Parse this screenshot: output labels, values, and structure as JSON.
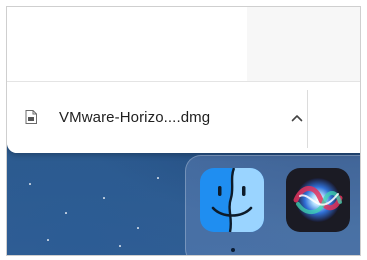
{
  "download_shelf": {
    "file_name": "VMware-Horizo....dmg",
    "file_icon": "file-icon",
    "menu_icon": "chevron-up-icon"
  },
  "dock": {
    "apps": [
      {
        "name": "Finder",
        "icon": "finder-icon",
        "running": true
      },
      {
        "name": "Siri",
        "icon": "siri-icon",
        "running": false
      }
    ]
  },
  "colors": {
    "wallpaper": "#2d5a8c",
    "finder_blue": "#1f8ef1",
    "finder_light": "#9ad4ff"
  }
}
